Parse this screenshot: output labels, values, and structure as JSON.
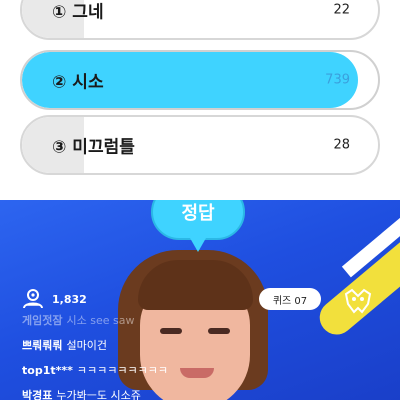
{
  "options": [
    {
      "label": "① 그네",
      "count": "22"
    },
    {
      "label": "② 시소",
      "count": "739"
    },
    {
      "label": "③ 미끄럼틀",
      "count": "28"
    }
  ],
  "answer_bubble": "정답",
  "viewer_count": "1,832",
  "quiz_badge": "퀴즈 07",
  "chat": [
    {
      "user": "게임젓잠",
      "message": "시소 see saw"
    },
    {
      "user": "쁘뤄뤄뤄",
      "message": "설마이건"
    },
    {
      "user": "top1t***",
      "message": "ㅋㅋㅋㅋㅋㅋㅋㅋㅋ"
    },
    {
      "user": "박경표",
      "message": "누가봐ㅡ도 시소쥬"
    }
  ],
  "colors": {
    "accent": "#3fd3ff",
    "stream_bg": "#2d65f0",
    "stripe": "#f2e03c"
  }
}
